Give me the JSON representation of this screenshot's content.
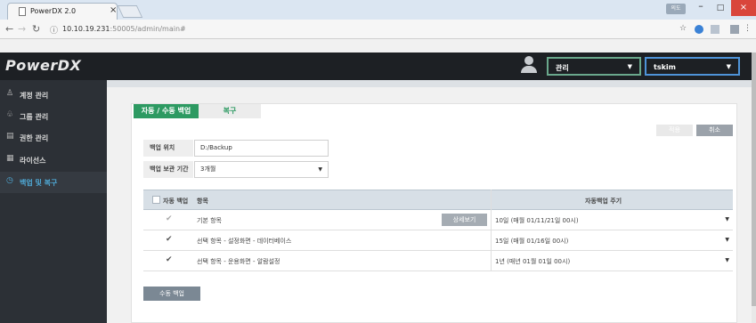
{
  "browser": {
    "tab_title": "PowerDX 2.0",
    "tab_close": "×",
    "url_host": "10.10.19.231",
    "url_rest": ":50005/admin/main#",
    "user_badge": "의도",
    "minimize": "–",
    "maximize": "□",
    "close": "×"
  },
  "header": {
    "logo": "PowerDX",
    "manage_select": "관리",
    "user_select": "tskim"
  },
  "sidebar": {
    "items": [
      {
        "label": "계정 관리",
        "icon": "user-icon"
      },
      {
        "label": "그룹 관리",
        "icon": "group-icon"
      },
      {
        "label": "권한 관리",
        "icon": "permission-icon"
      },
      {
        "label": "라이선스",
        "icon": "license-icon"
      },
      {
        "label": "백업 및 복구",
        "icon": "clock-icon"
      }
    ]
  },
  "tabs": {
    "active": "자동 / 수동 백업",
    "inactive": "복구"
  },
  "actions": {
    "save": "적용",
    "cancel": "취소",
    "manual_backup": "수동 백업"
  },
  "form": {
    "location_label": "백업 위치",
    "location_value": "D:/Backup",
    "retention_label": "백업 보관 기간",
    "retention_value": "3개월"
  },
  "table": {
    "col_auto": "자동 백업",
    "col_item": "항목",
    "col_period": "자동백업 주기",
    "detail_button": "상세보기",
    "rows": [
      {
        "item": "기본 항목",
        "period": "10일 (매월 01/11/21일 00시)"
      },
      {
        "item": "선택 항목 - 설정화면 - 데이터베이스",
        "period": "15일 (매월 01/16일 00시)"
      },
      {
        "item": "선택 항목 - 운용화면 - 알람설정",
        "period": "1년 (매년 01월 01일 00시)"
      }
    ]
  }
}
